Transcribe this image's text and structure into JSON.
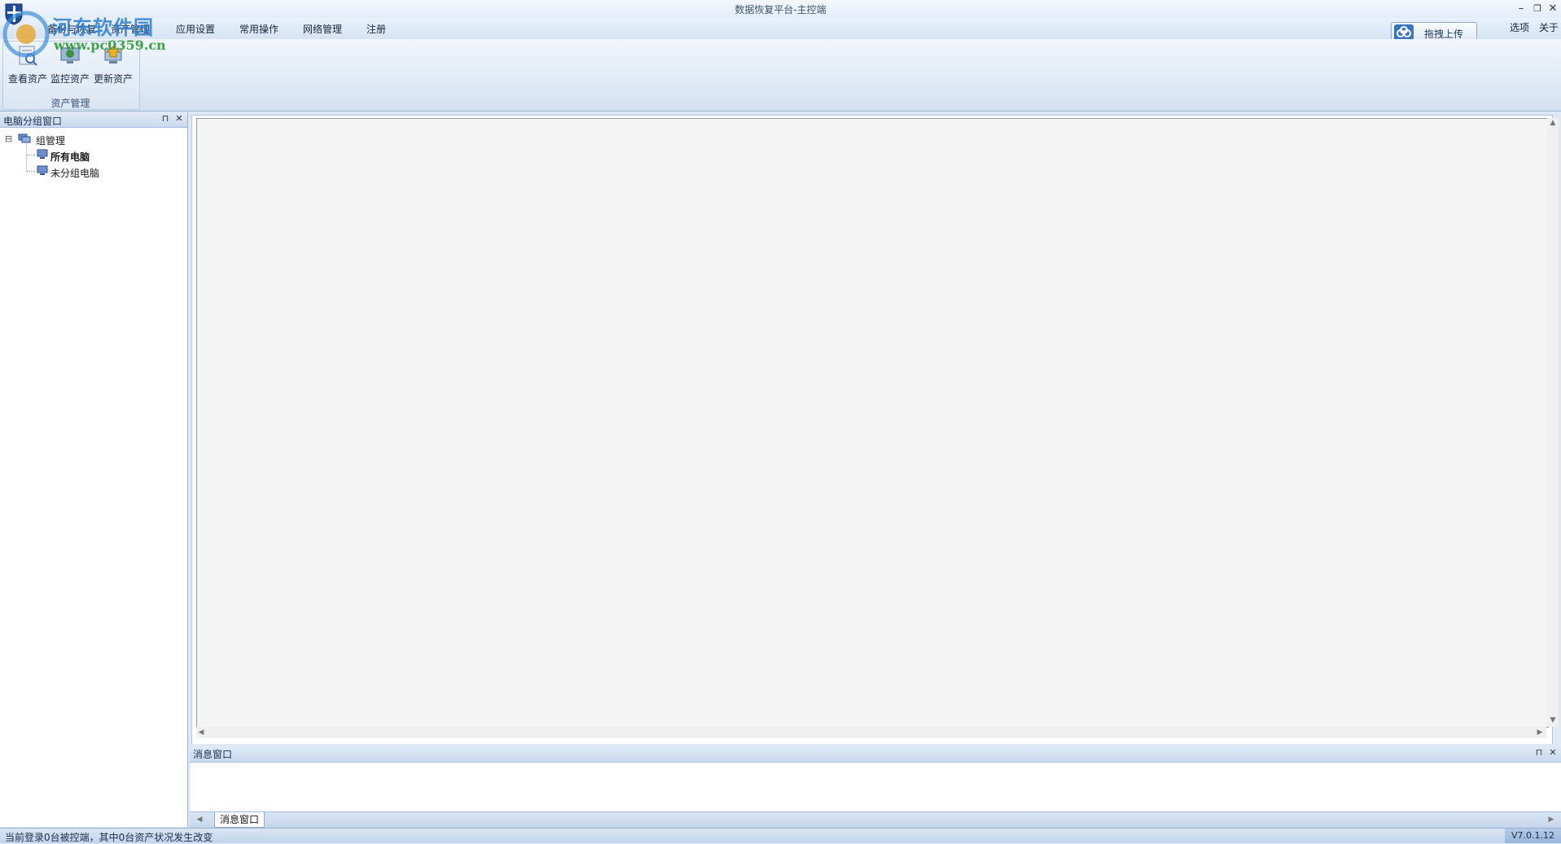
{
  "window": {
    "title": "数据恢复平台-主控端",
    "min_glyph": "–",
    "restore_glyph": "❐",
    "close_glyph": "✕"
  },
  "watermark": {
    "line1": "河东软件园",
    "line2": "www.pc0359.cn"
  },
  "menu": {
    "items": [
      "备份与恢复",
      "资产管理",
      "应用设置",
      "常用操作",
      "网络管理",
      "注册"
    ],
    "right_items": [
      "选项",
      "关于"
    ]
  },
  "upload_button": {
    "label": "拖拽上传"
  },
  "ribbon": {
    "group_label": "资产管理",
    "buttons": [
      {
        "label": "查看资产",
        "icon": "view-assets-icon"
      },
      {
        "label": "监控资产",
        "icon": "monitor-assets-icon"
      },
      {
        "label": "更新资产",
        "icon": "update-assets-icon"
      }
    ]
  },
  "left_panel": {
    "title": "电脑分组窗口",
    "pin_glyph": "⊓",
    "close_glyph": "✕",
    "tree": {
      "root": {
        "label": "组管理",
        "expander": "⊟"
      },
      "children": [
        {
          "label": "所有电脑",
          "bold": true
        },
        {
          "label": "未分组电脑",
          "bold": false
        }
      ]
    }
  },
  "message_panel": {
    "title": "消息窗口",
    "tab_label": "消息窗口",
    "pin_glyph": "⊓",
    "close_glyph": "✕"
  },
  "statusbar": {
    "message": "当前登录0台被控端，其中0台资产状况发生改变",
    "version": "V7.0.1.12"
  },
  "colors": {
    "accent": "#3a75c4",
    "panel_header": "#c9d9ee",
    "canvas": "#f4f4f4"
  }
}
